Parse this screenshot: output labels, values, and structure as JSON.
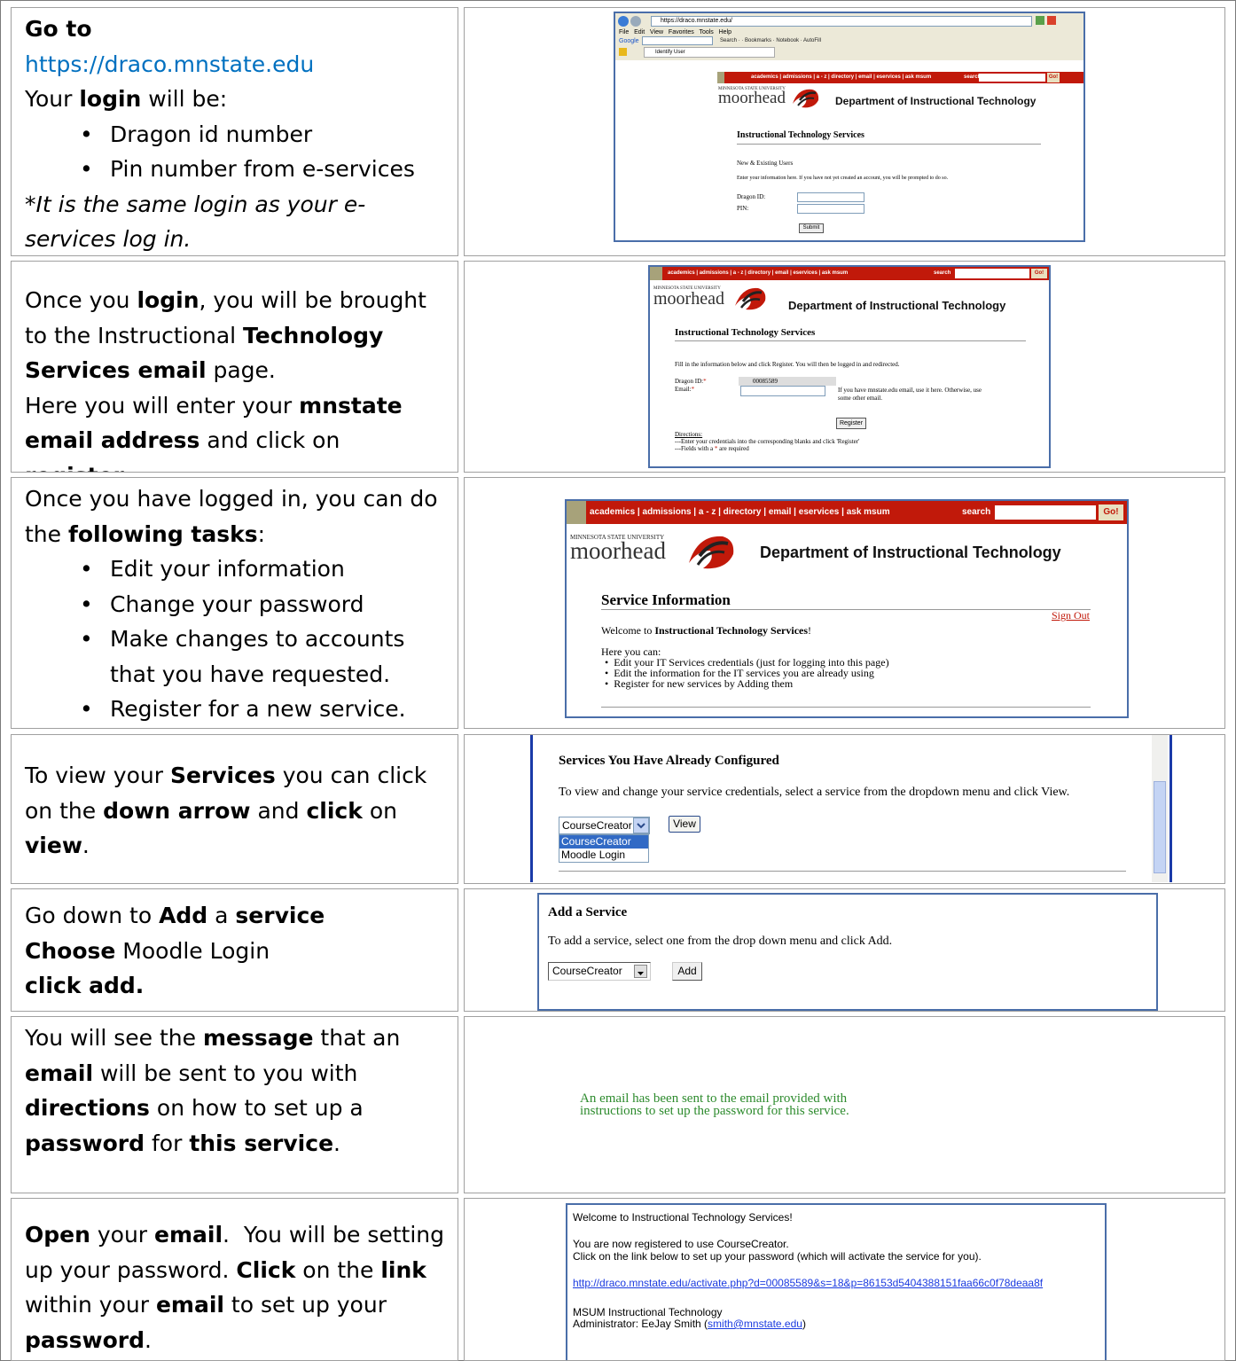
{
  "steps": [
    {
      "left": {
        "go_to": "Go to",
        "url": "https://draco.mnstate.edu",
        "login_pre": "Your ",
        "login_bold": "login",
        "login_post": " will be:",
        "bullets": [
          "Dragon id number",
          "Pin number from e-services"
        ],
        "note": "*It is the same login as your e-services log in."
      },
      "screenshot": {
        "address": "https://draco.mnstate.edu/",
        "menu": [
          "File",
          "Edit",
          "View",
          "Favorites",
          "Tools",
          "Help"
        ],
        "google": "Google",
        "google_toolbar": "Search · · Bookmarks · Notebook · AutoFill",
        "tab": "Identify User",
        "nav": "academics | admissions | a - z | directory | email | eservices | ask msum",
        "search": "search",
        "go": "Go!",
        "logo_top": "MINNESOTA STATE UNIVERSITY",
        "logo_main": "moorhead",
        "dept": "Department of Instructional Technology",
        "heading": "Instructional Technology Services",
        "sub": "New & Existing Users",
        "instructions": "Enter your information here. If you have not yet created an account, you will be prompted to do so.",
        "dragon_label": "Dragon ID:",
        "pin_label": "PIN:",
        "submit": "Submit"
      }
    },
    {
      "left": {
        "p1a": "Once you ",
        "p1b": "login",
        "p1c": ", you will be brought to the Instructional ",
        "p1d": "Technology Services email",
        "p1e": " page.",
        "p2a": "Here you will enter your ",
        "p2b": "mnstate email address",
        "p2c": " and click on ",
        "p2d": "register",
        "p2e": "."
      },
      "screenshot": {
        "nav": "academics | admissions | a - z | directory | email | eservices | ask msum",
        "search": "search",
        "go": "Go!",
        "logo_top": "MINNESOTA STATE UNIVERSITY",
        "logo_main": "moorhead",
        "dept": "Department of Instructional Technology",
        "heading": "Instructional Technology Services",
        "instructions": "Fill in the information below and click Register. You will then be logged in and redirected.",
        "dragon_label": "Dragon ID:",
        "star": "*",
        "dragon_value": "00085589",
        "email_label": "Email:",
        "email_note_1": "If you have mnstate.edu email, use it here. Otherwise, use",
        "email_note_2": "some other email.",
        "register": "Register",
        "directions_title": "Directions:",
        "dir1": "---Enter your credentials into the corresponding blanks and click 'Register'",
        "dir2a": "---Fields with a ",
        "dir2b": " are required"
      }
    },
    {
      "left": {
        "p1a": "Once you have logged in, you can do the ",
        "p1b": "following tasks",
        "p1c": ":",
        "bullets": [
          "Edit your information",
          "Change your password",
          "Make changes to accounts that you have requested.",
          "Register for a new service."
        ]
      },
      "screenshot": {
        "nav": "academics | admissions | a - z | directory | email | eservices | ask msum",
        "search": "search",
        "go": "Go!",
        "logo_top": "MINNESOTA STATE UNIVERSITY",
        "logo_main": "moorhead",
        "dept": "Department of Instructional Technology",
        "heading": "Service Information",
        "sign_out": "Sign Out",
        "welcome_a": "Welcome to ",
        "welcome_b": "Instructional Technology Services",
        "welcome_c": "!",
        "here": "Here you can:",
        "items": [
          "Edit your IT Services credentials (just for logging into this page)",
          "Edit the information for the IT services you are already using",
          "Register for new services by Adding them"
        ]
      }
    },
    {
      "left": {
        "a": "To view your ",
        "b": "Services",
        "c": " you can click on the ",
        "d": "down arrow",
        "e": " and ",
        "f": "click",
        "g": " on ",
        "h": "view",
        "i": "."
      },
      "screenshot": {
        "heading": "Services You Have Already Configured",
        "instructions": "To view and change your service credentials, select a service from the dropdown menu and click View.",
        "select_value": "CourseCreator",
        "view": "View",
        "options": [
          "CourseCreator",
          "Moodle Login"
        ]
      }
    },
    {
      "left": {
        "a": "Go down to ",
        "b": "Add",
        "c": " a ",
        "d": "service",
        "e": "Choose",
        "f": " Moodle Login",
        "g": "click add."
      },
      "screenshot": {
        "heading": "Add a Service",
        "instructions": "To add a service, select one from the drop down menu and click Add.",
        "select_value": "CourseCreator",
        "add": "Add"
      }
    },
    {
      "left": {
        "a": "You will see the ",
        "b": "message",
        "c": " that an ",
        "d": "email",
        "e": " will be sent to you with ",
        "f": "directions",
        "g": " on how to set up a ",
        "h": "password",
        "i": " for ",
        "j": "this service",
        "k": "."
      },
      "screenshot": {
        "line1": "An email has been sent to the email provided with",
        "line2": "instructions to set up the password for this service."
      }
    },
    {
      "left": {
        "a": "Open",
        "b": " your ",
        "c": "email",
        "d": ".  You will be setting up your password. ",
        "e": "Click",
        "f": " on the ",
        "g": "link",
        "h": " within your ",
        "i": "email",
        "j": " to set up your ",
        "k": "password",
        "l": "."
      },
      "screenshot": {
        "welcome": "Welcome to Instructional Technology Services!",
        "reg": "You are now registered to use CourseCreator.",
        "click": "Click on the link below to set up your password (which will activate the service for you).",
        "link": "http://draco.mnstate.edu/activate.php?d=00085589&s=18&p=86153d5404388151faa66c0f78deaa8f",
        "sig1": "MSUM Instructional Technology",
        "sig2a": "Administrator: EeJay Smith (",
        "sig2b": "smith@mnstate.edu",
        "sig2c": ")"
      }
    }
  ]
}
